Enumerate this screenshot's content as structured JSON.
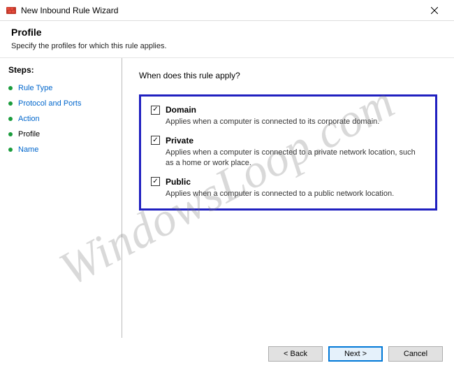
{
  "window": {
    "title": "New Inbound Rule Wizard"
  },
  "header": {
    "title": "Profile",
    "subtitle": "Specify the profiles for which this rule applies."
  },
  "sidebar": {
    "label": "Steps:",
    "items": [
      {
        "label": "Rule Type",
        "current": false
      },
      {
        "label": "Protocol and Ports",
        "current": false
      },
      {
        "label": "Action",
        "current": false
      },
      {
        "label": "Profile",
        "current": true
      },
      {
        "label": "Name",
        "current": false
      }
    ]
  },
  "content": {
    "question": "When does this rule apply?",
    "options": [
      {
        "label": "Domain",
        "checked": true,
        "desc": "Applies when a computer is connected to its corporate domain."
      },
      {
        "label": "Private",
        "checked": true,
        "desc": "Applies when a computer is connected to a private network location, such as a home or work place."
      },
      {
        "label": "Public",
        "checked": true,
        "desc": "Applies when a computer is connected to a public network location."
      }
    ]
  },
  "buttons": {
    "back": "< Back",
    "next": "Next >",
    "cancel": "Cancel"
  },
  "watermark": "WindowsLoop.com"
}
